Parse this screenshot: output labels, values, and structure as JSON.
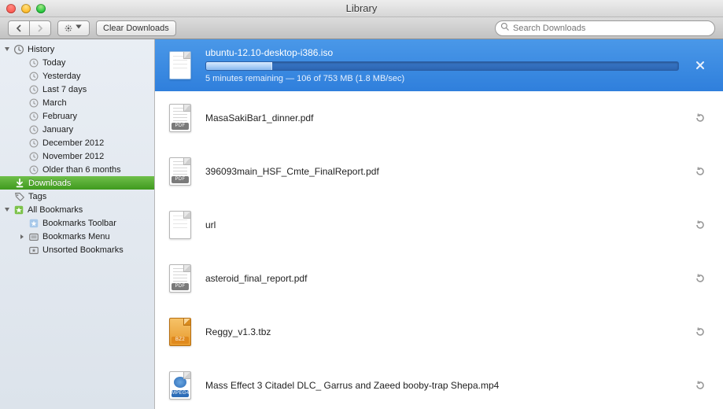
{
  "window": {
    "title": "Library"
  },
  "toolbar": {
    "clear_label": "Clear Downloads",
    "search_placeholder": "Search Downloads"
  },
  "sidebar": {
    "history_label": "History",
    "history_items": [
      "Today",
      "Yesterday",
      "Last 7 days",
      "March",
      "February",
      "January",
      "December 2012",
      "November 2012",
      "Older than 6 months"
    ],
    "downloads_label": "Downloads",
    "tags_label": "Tags",
    "all_bookmarks_label": "All Bookmarks",
    "bookmarks_items": [
      "Bookmarks Toolbar",
      "Bookmarks Menu",
      "Unsorted Bookmarks"
    ]
  },
  "download_active": {
    "name": "ubuntu-12.10-desktop-i386.iso",
    "status": "5 minutes remaining — 106 of 753 MB (1.8 MB/sec)",
    "progress_percent": 14
  },
  "downloads": [
    {
      "name": "MasaSakiBar1_dinner.pdf",
      "type": "pdf"
    },
    {
      "name": "396093main_HSF_Cmte_FinalReport.pdf",
      "type": "pdf"
    },
    {
      "name": "url",
      "type": "plain"
    },
    {
      "name": "asteroid_final_report.pdf",
      "type": "pdf"
    },
    {
      "name": "Reggy_v1.3.tbz",
      "type": "bz2"
    },
    {
      "name": "Mass Effect 3 Citadel DLC_ Garrus and Zaeed booby-trap Shepa.mp4",
      "type": "mp4"
    }
  ]
}
